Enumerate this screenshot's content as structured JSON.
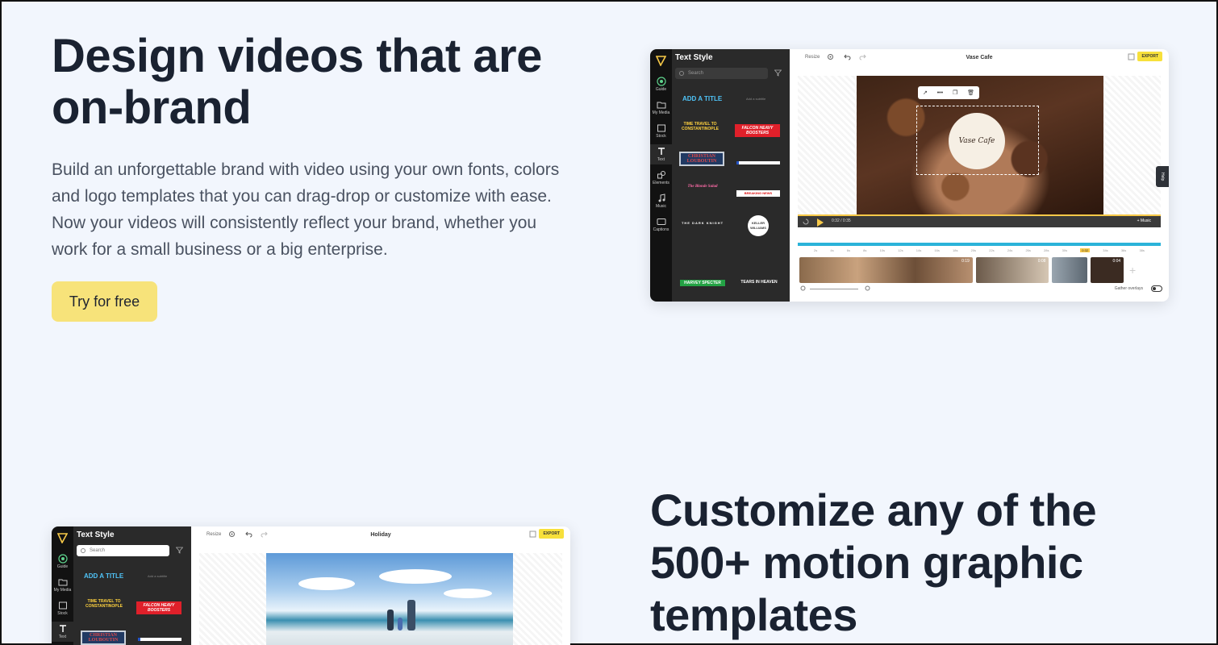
{
  "hero": {
    "title": "Design videos that are on-brand",
    "description": "Build an unforgettable brand with video using your own fonts, colors and logo templates that you can drag-drop or customize with ease. Now your videos will consistently reflect your brand, whether you work for a small business or a big enterprise.",
    "cta_label": "Try for free"
  },
  "section2": {
    "title": "Customize any of the 500+ motion graphic templates"
  },
  "editor1": {
    "panel_title": "Text Style",
    "search_placeholder": "Search",
    "add_title": "ADD A TITLE",
    "add_subtitle": "Add a subtitle",
    "rail": [
      "Guide",
      "My Media",
      "Stock",
      "Text",
      "Elements",
      "Music",
      "Captions"
    ],
    "tiles": [
      "TIME TRAVEL TO CONSTANTINOPLE",
      "FALCON HEAVY BOOSTERS",
      "CHRISTIAN LOUBOUTIN",
      "The Blonde Salad",
      "BREAKING NEWS",
      "THE DARK KNIGHT",
      "KELLER WILLIAMS",
      "HARVEY SPECTER",
      "TEARS IN HEAVEN"
    ],
    "toolbar": {
      "resize": "Resize",
      "project_name": "Vase Cafe",
      "export": "EXPORT"
    },
    "logo_text": "Vase Cafe",
    "player": {
      "time": "0:32 / 0:35",
      "music": "+ Music"
    },
    "ticks": [
      "2s",
      "4s",
      "6s",
      "8s",
      "10s",
      "12s",
      "14s",
      "16s",
      "18s",
      "20s",
      "22s",
      "24s",
      "26s",
      "28s",
      "30s",
      "0:32",
      "34s",
      "36s",
      "38s"
    ],
    "clips": [
      {
        "duration": "0:19",
        "color": "#8a6a4c"
      },
      {
        "duration": "0:08",
        "color": "#6b5a4a"
      },
      {
        "duration": "",
        "color": "#9aa6b0"
      },
      {
        "duration": "0:04",
        "color": "#3b2b22"
      }
    ],
    "help": "Help",
    "gather_overlays": "Gather overlays"
  },
  "editor2": {
    "panel_title": "Text Style",
    "search_placeholder": "Search",
    "add_title": "ADD A TITLE",
    "add_subtitle": "Add a subtitle",
    "rail": [
      "Guide",
      "My Media",
      "Stock",
      "Text"
    ],
    "tiles": [
      "TIME TRAVEL TO CONSTANTINOPLE",
      "FALCON HEAVY BOOSTERS",
      "CHRISTIAN LOUBOUTIN"
    ],
    "toolbar": {
      "resize": "Resize",
      "project_name": "Holiday",
      "export": "EXPORT"
    }
  },
  "colors": {
    "background": "#f2f6fd",
    "cta": "#f7e37a",
    "export": "#f7e03b",
    "accent_blue": "#2bb3d9"
  }
}
